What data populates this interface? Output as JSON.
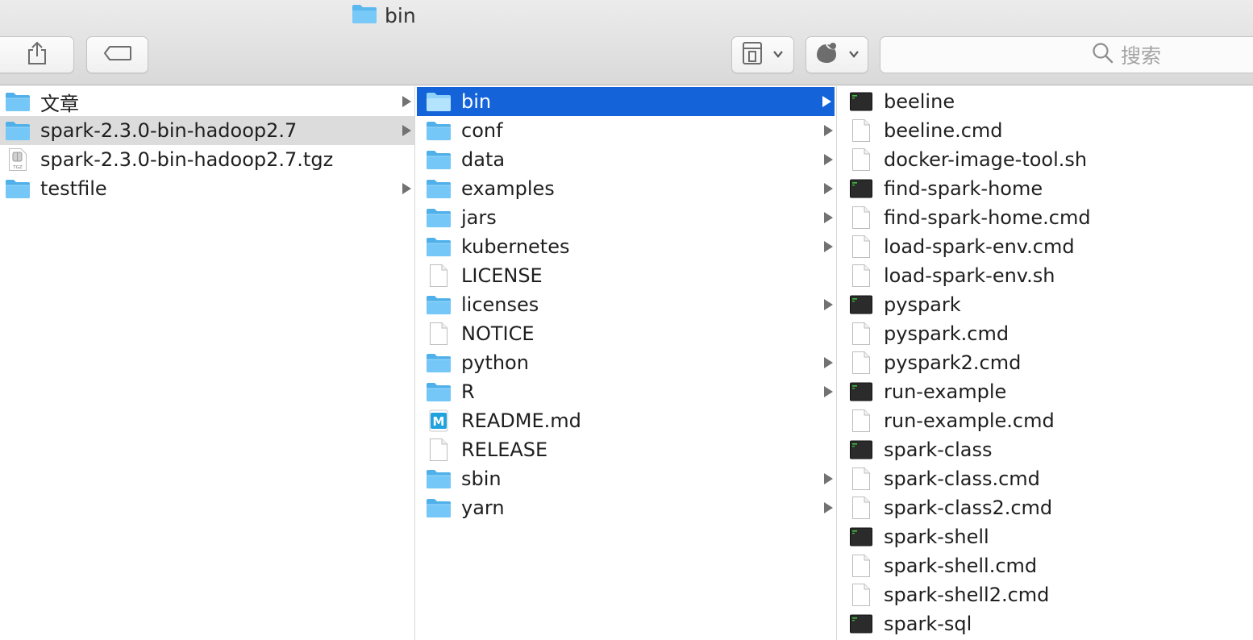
{
  "window": {
    "title": "bin"
  },
  "toolbar": {
    "share_icon": "share-icon",
    "tag_icon": "tag-icon",
    "view_options_icon": "view-options-icon",
    "action_icon": "action-gear-icon",
    "search_placeholder": "搜索"
  },
  "colors": {
    "selection_blue": "#1463d8",
    "folder_blue": "#6fc4f5",
    "inactive_selection": "#dcdcdc"
  },
  "columns": [
    {
      "items": [
        {
          "name": "文章",
          "icon": "folder-icon",
          "has_children": true,
          "state": ""
        },
        {
          "name": "spark-2.3.0-bin-hadoop2.7",
          "icon": "folder-icon",
          "has_children": true,
          "state": "selected-inactive"
        },
        {
          "name": "spark-2.3.0-bin-hadoop2.7.tgz",
          "icon": "tgz-archive-icon",
          "has_children": false,
          "state": ""
        },
        {
          "name": "testfile",
          "icon": "folder-icon",
          "has_children": true,
          "state": ""
        }
      ]
    },
    {
      "items": [
        {
          "name": "bin",
          "icon": "folder-icon",
          "has_children": true,
          "state": "selected-active"
        },
        {
          "name": "conf",
          "icon": "folder-icon",
          "has_children": true,
          "state": ""
        },
        {
          "name": "data",
          "icon": "folder-icon",
          "has_children": true,
          "state": ""
        },
        {
          "name": "examples",
          "icon": "folder-icon",
          "has_children": true,
          "state": ""
        },
        {
          "name": "jars",
          "icon": "folder-icon",
          "has_children": true,
          "state": ""
        },
        {
          "name": "kubernetes",
          "icon": "folder-icon",
          "has_children": true,
          "state": ""
        },
        {
          "name": "LICENSE",
          "icon": "document-icon",
          "has_children": false,
          "state": ""
        },
        {
          "name": "licenses",
          "icon": "folder-icon",
          "has_children": true,
          "state": ""
        },
        {
          "name": "NOTICE",
          "icon": "document-icon",
          "has_children": false,
          "state": ""
        },
        {
          "name": "python",
          "icon": "folder-icon",
          "has_children": true,
          "state": ""
        },
        {
          "name": "R",
          "icon": "folder-icon",
          "has_children": true,
          "state": ""
        },
        {
          "name": "README.md",
          "icon": "markdown-icon",
          "has_children": false,
          "state": ""
        },
        {
          "name": "RELEASE",
          "icon": "document-icon",
          "has_children": false,
          "state": ""
        },
        {
          "name": "sbin",
          "icon": "folder-icon",
          "has_children": true,
          "state": ""
        },
        {
          "name": "yarn",
          "icon": "folder-icon",
          "has_children": true,
          "state": ""
        }
      ]
    },
    {
      "items": [
        {
          "name": "beeline",
          "icon": "terminal-icon",
          "has_children": false,
          "state": ""
        },
        {
          "name": "beeline.cmd",
          "icon": "document-icon",
          "has_children": false,
          "state": ""
        },
        {
          "name": "docker-image-tool.sh",
          "icon": "document-icon",
          "has_children": false,
          "state": ""
        },
        {
          "name": "find-spark-home",
          "icon": "terminal-icon",
          "has_children": false,
          "state": ""
        },
        {
          "name": "find-spark-home.cmd",
          "icon": "document-icon",
          "has_children": false,
          "state": ""
        },
        {
          "name": "load-spark-env.cmd",
          "icon": "document-icon",
          "has_children": false,
          "state": ""
        },
        {
          "name": "load-spark-env.sh",
          "icon": "document-icon",
          "has_children": false,
          "state": ""
        },
        {
          "name": "pyspark",
          "icon": "terminal-icon",
          "has_children": false,
          "state": ""
        },
        {
          "name": "pyspark.cmd",
          "icon": "document-icon",
          "has_children": false,
          "state": ""
        },
        {
          "name": "pyspark2.cmd",
          "icon": "document-icon",
          "has_children": false,
          "state": ""
        },
        {
          "name": "run-example",
          "icon": "terminal-icon",
          "has_children": false,
          "state": ""
        },
        {
          "name": "run-example.cmd",
          "icon": "document-icon",
          "has_children": false,
          "state": ""
        },
        {
          "name": "spark-class",
          "icon": "terminal-icon",
          "has_children": false,
          "state": ""
        },
        {
          "name": "spark-class.cmd",
          "icon": "document-icon",
          "has_children": false,
          "state": ""
        },
        {
          "name": "spark-class2.cmd",
          "icon": "document-icon",
          "has_children": false,
          "state": ""
        },
        {
          "name": "spark-shell",
          "icon": "terminal-icon",
          "has_children": false,
          "state": ""
        },
        {
          "name": "spark-shell.cmd",
          "icon": "document-icon",
          "has_children": false,
          "state": ""
        },
        {
          "name": "spark-shell2.cmd",
          "icon": "document-icon",
          "has_children": false,
          "state": ""
        },
        {
          "name": "spark-sql",
          "icon": "terminal-icon",
          "has_children": false,
          "state": ""
        }
      ]
    }
  ]
}
